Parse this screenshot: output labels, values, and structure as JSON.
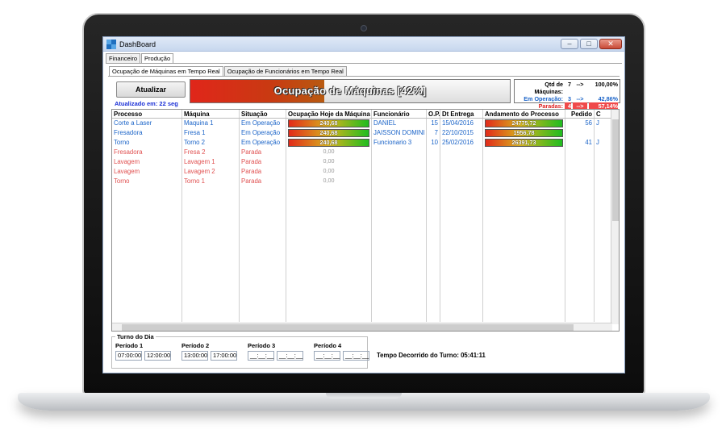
{
  "window": {
    "title": "DashBoard",
    "min": "–",
    "max": "□",
    "close": "✕"
  },
  "tabs": [
    "Financeiro",
    "Produção"
  ],
  "subtabs": [
    "Ocupação de Máquinas em Tempo Real",
    "Ocupação de Funcionários em Tempo Real"
  ],
  "update_button": "Atualizar",
  "updated_label": "Atualizado em: 22 seg",
  "occupancy": {
    "label": "Ocupação de Máquinas [42%]",
    "percent": 42
  },
  "summary": {
    "total_label": "Qtd de Máquinas:",
    "total": "7",
    "total_arrow": "-->",
    "total_pct": "100,00%",
    "op_label": "Em Operação:",
    "op": "3",
    "op_arrow": "-->",
    "op_pct": "42,86%",
    "stop_label": "Paradas:",
    "stop": "4",
    "stop_arrow": "-->",
    "stop_pct": "57,14%"
  },
  "columns": [
    "Processo",
    "Máquina",
    "Situação",
    "Ocupação Hoje da Máquina",
    "Funcionário",
    "O.P.",
    "Dt Entrega",
    "Andamento do Processo",
    "Pedido",
    "C"
  ],
  "rows": [
    {
      "processo": "Corte a Laser",
      "maquina": "Maquina 1",
      "situacao": "Em Operação",
      "ocupacao": "240,68",
      "funcionario": "DANIEL",
      "op": "15",
      "entrega": "15/04/2016",
      "andamento": "24775,72",
      "pedido": "56",
      "c": "J",
      "status": "op"
    },
    {
      "processo": "Fresadora",
      "maquina": "Fresa 1",
      "situacao": "Em Operação",
      "ocupacao": "240,68",
      "funcionario": "JAISSON DOMINI",
      "op": "7",
      "entrega": "22/10/2015",
      "andamento": "1956,78",
      "pedido": "",
      "c": "",
      "status": "op"
    },
    {
      "processo": "Torno",
      "maquina": "Torno 2",
      "situacao": "Em Operação",
      "ocupacao": "240,68",
      "funcionario": "Funcionario 3",
      "op": "10",
      "entrega": "25/02/2016",
      "andamento": "26391,73",
      "pedido": "41",
      "c": "J",
      "status": "op"
    },
    {
      "processo": "Fresadora",
      "maquina": "Fresa 2",
      "situacao": "Parada",
      "ocupacao": "0,00",
      "funcionario": "",
      "op": "",
      "entrega": "",
      "andamento": "",
      "pedido": "",
      "c": "",
      "status": "stop"
    },
    {
      "processo": "Lavagem",
      "maquina": "Lavagem 1",
      "situacao": "Parada",
      "ocupacao": "0,00",
      "funcionario": "",
      "op": "",
      "entrega": "",
      "andamento": "",
      "pedido": "",
      "c": "",
      "status": "stop"
    },
    {
      "processo": "Lavagem",
      "maquina": "Lavagem 2",
      "situacao": "Parada",
      "ocupacao": "0,00",
      "funcionario": "",
      "op": "",
      "entrega": "",
      "andamento": "",
      "pedido": "",
      "c": "",
      "status": "stop"
    },
    {
      "processo": "Torno",
      "maquina": "Torno 1",
      "situacao": "Parada",
      "ocupacao": "0,00",
      "funcionario": "",
      "op": "",
      "entrega": "",
      "andamento": "",
      "pedido": "",
      "c": "",
      "status": "stop"
    }
  ],
  "turno": {
    "legend": "Turno do Dia",
    "periods": [
      {
        "label": "Período 1",
        "start": "07:00:00",
        "end": "12:00:00"
      },
      {
        "label": "Período 2",
        "start": "13:00:00",
        "end": "17:00:00"
      },
      {
        "label": "Período 3",
        "start": "__:__:__",
        "end": "__:__:__"
      },
      {
        "label": "Período 4",
        "start": "__:__:__",
        "end": "__:__:__"
      }
    ]
  },
  "tempo_decorrido": "Tempo Decorrido do Turno: 05:41:11"
}
